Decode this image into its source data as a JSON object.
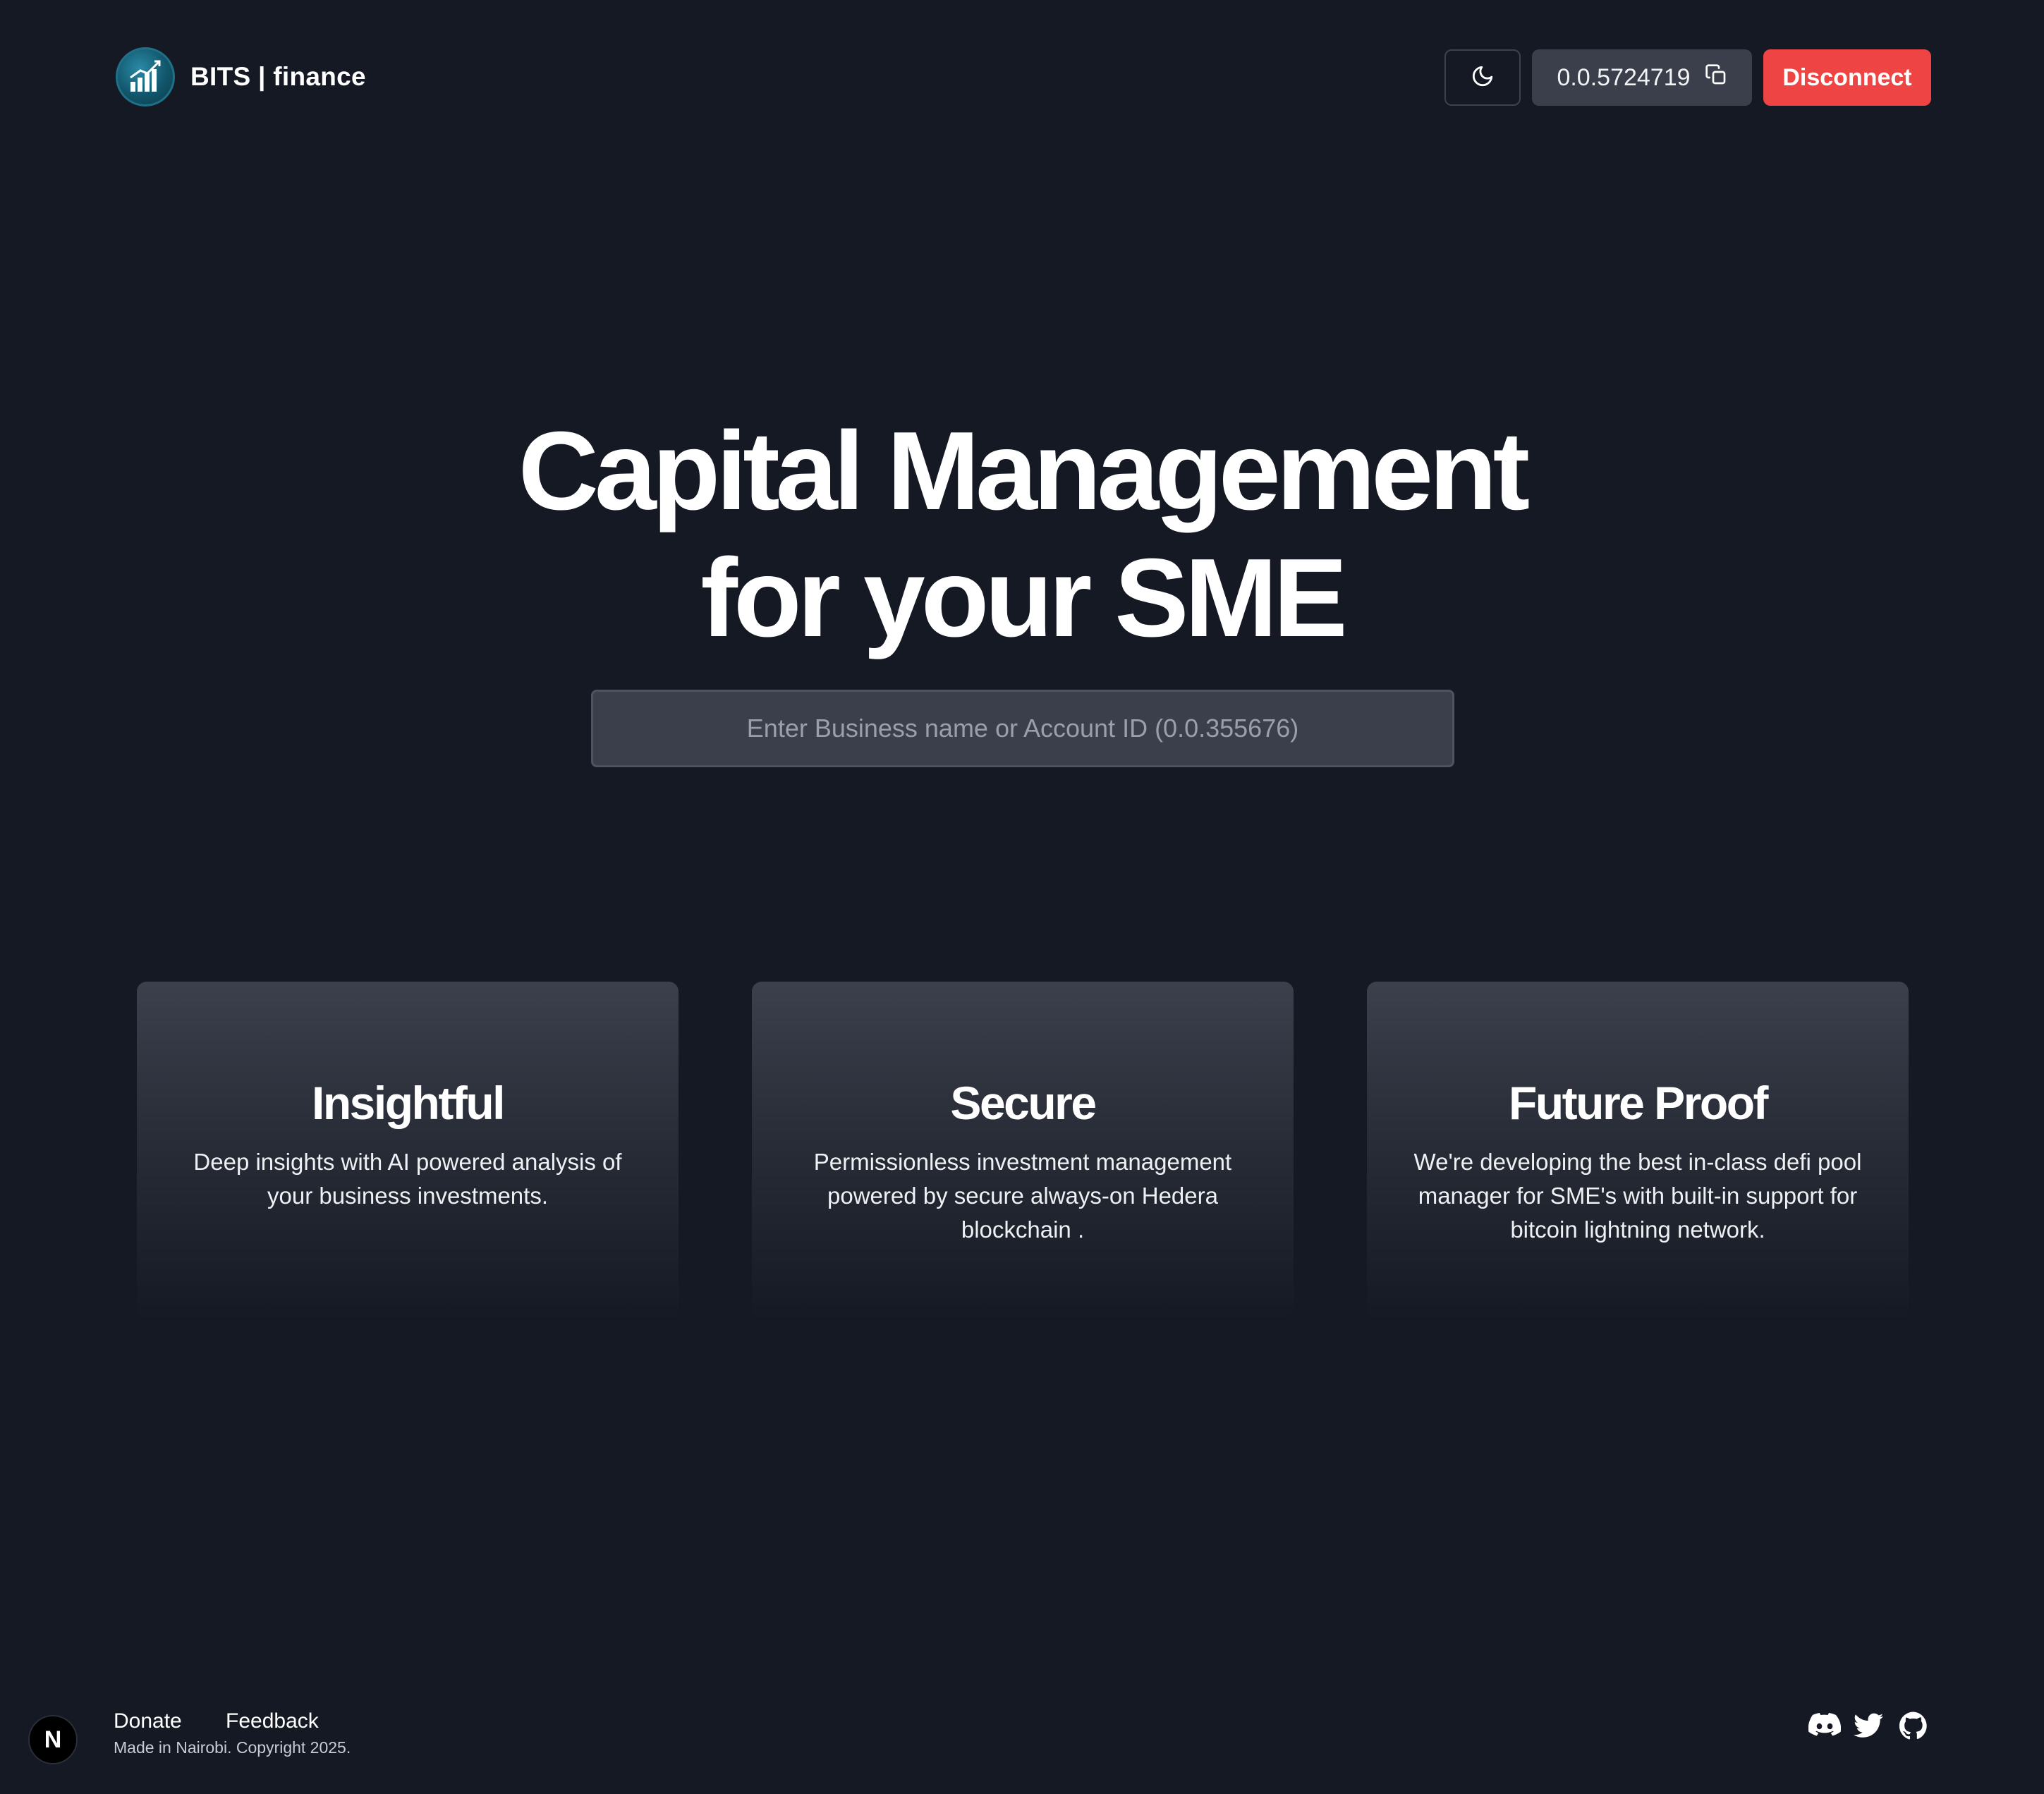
{
  "header": {
    "logo_text": "BITS | finance",
    "logo_icon": "chart-growth-icon",
    "theme_toggle_icon": "moon-icon",
    "account_id": "0.0.5724719",
    "copy_icon": "copy-icon",
    "disconnect_label": "Disconnect"
  },
  "hero": {
    "title_line1": "Capital Management",
    "title_line2": "for your SME",
    "search_placeholder": "Enter Business name or Account ID (0.0.355676)"
  },
  "features": [
    {
      "title": "Insightful",
      "text": "Deep insights with AI powered analysis of your business investments."
    },
    {
      "title": "Secure",
      "text": "Permissionless investment management powered by secure always-on Hedera blockchain ."
    },
    {
      "title": "Future Proof",
      "text": "We're developing the best in-class defi pool manager for SME's with built-in support for bitcoin lightning network."
    }
  ],
  "footer": {
    "badge_letter": "N",
    "donate_label": "Donate",
    "feedback_label": "Feedback",
    "copyright": "Made in Nairobi. Copyright 2025.",
    "social_icons": [
      "discord-icon",
      "twitter-icon",
      "github-icon"
    ]
  },
  "colors": {
    "background": "#151923",
    "disconnect": "#ef4444",
    "input_bg": "#3a3f4b",
    "logo_teal": "#12566c"
  }
}
